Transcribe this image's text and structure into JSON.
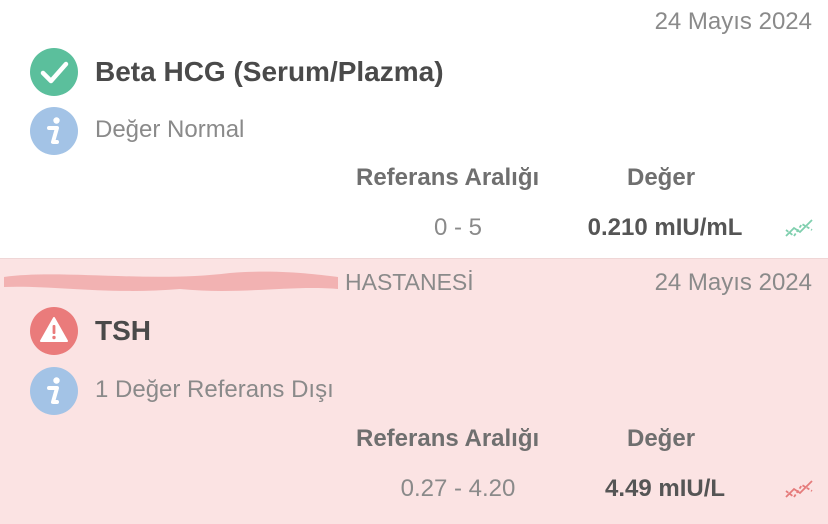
{
  "results": [
    {
      "date": "24 Mayıs 2024",
      "status_icon": "check-icon",
      "test_name": "Beta HCG (Serum/Plazma)",
      "info_text": "Değer Normal",
      "range_header": "Referans Aralığı",
      "value_header": "Değer",
      "reference_range": "0 - 5",
      "value": "0.210 mIU/mL",
      "trend_icon": "trend-chart-icon",
      "accent": "#5bbf9c"
    },
    {
      "hospital": "HASTANESİ",
      "date": "24 Mayıs 2024",
      "status_icon": "warning-icon",
      "test_name": "TSH",
      "info_text": "1 Değer Referans Dışı",
      "range_header": "Referans Aralığı",
      "value_header": "Değer",
      "reference_range": "0.27 - 4.20",
      "value": "4.49 mIU/L",
      "trend_icon": "trend-chart-icon",
      "accent": "#ea7b7b"
    }
  ]
}
